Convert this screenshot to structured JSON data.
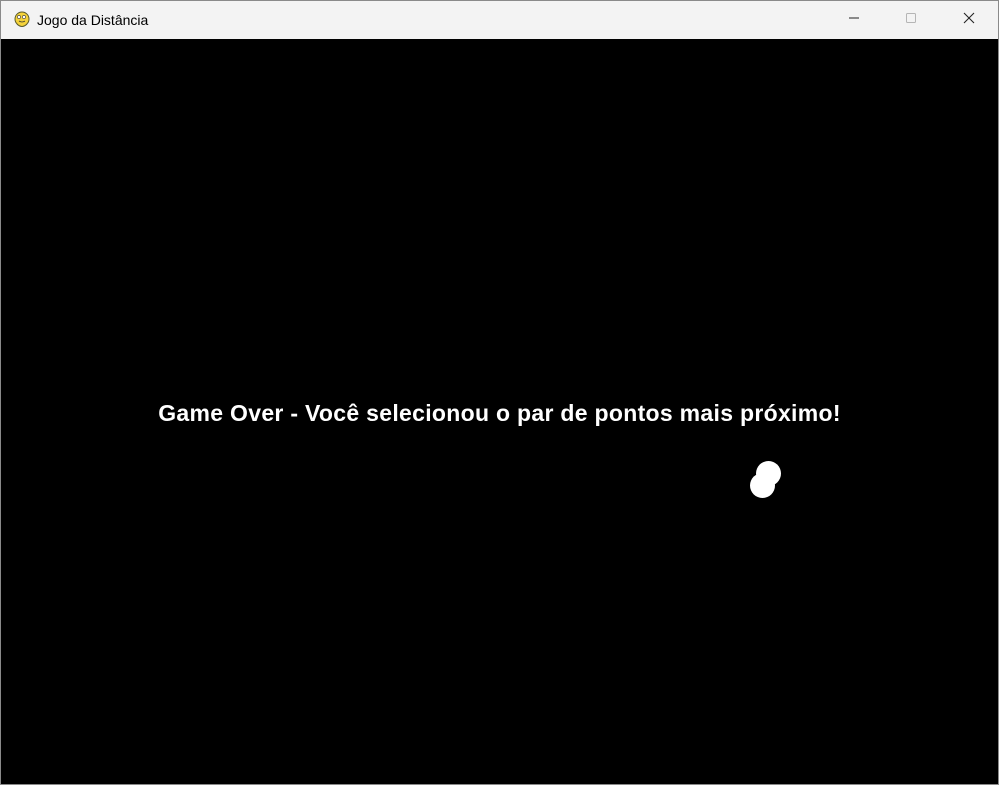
{
  "window": {
    "title": "Jogo da Distância",
    "icon": "pygame-snake-icon",
    "controls": {
      "minimize": "minimize-icon",
      "maximize": "maximize-icon",
      "close": "close-icon"
    }
  },
  "game": {
    "background_color": "#000000",
    "message": "Game Over - Você selecionou o par de pontos mais próximo!",
    "point_color": "#ffffff"
  }
}
